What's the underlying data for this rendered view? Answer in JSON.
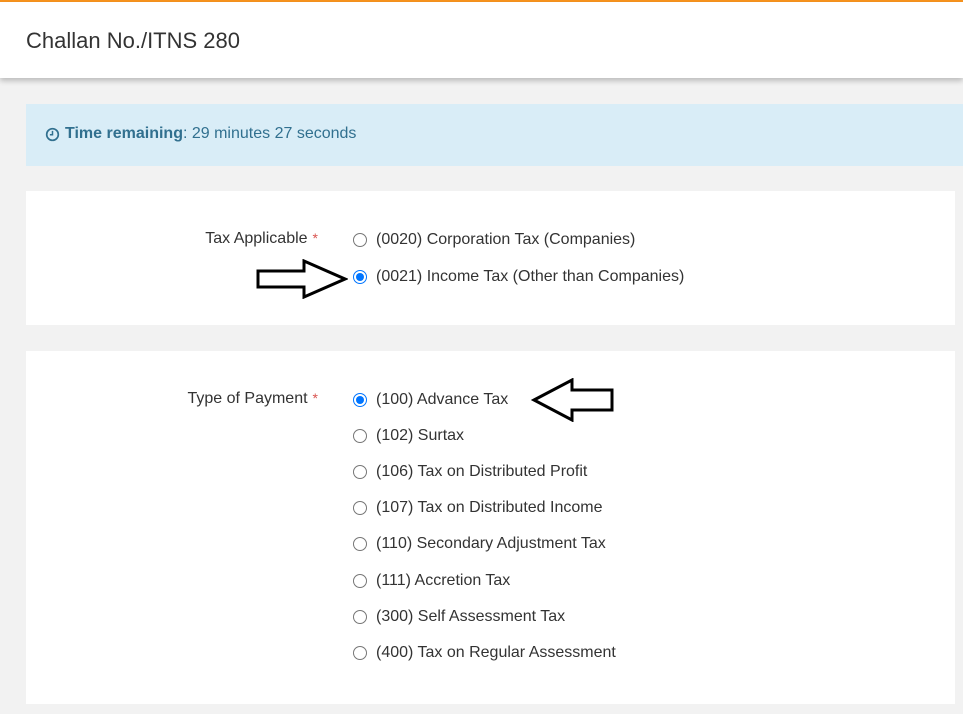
{
  "header": {
    "title": "Challan No./ITNS 280"
  },
  "timer": {
    "icon": "clock-icon",
    "label": "Time remaining",
    "value": ": 29 minutes 27 seconds"
  },
  "tax_applicable": {
    "label": "Tax Applicable",
    "required_mark": "*",
    "selected": "(0021) Income Tax (Other than Companies)",
    "options": [
      {
        "label": "(0020) Corporation Tax (Companies)",
        "checked": false
      },
      {
        "label": "(0021) Income Tax (Other than Companies)",
        "checked": true
      }
    ]
  },
  "type_of_payment": {
    "label": "Type of Payment",
    "required_mark": "*",
    "selected": "(100) Advance Tax",
    "options": [
      {
        "label": "(100) Advance Tax",
        "checked": true
      },
      {
        "label": "(102) Surtax",
        "checked": false
      },
      {
        "label": "(106) Tax on Distributed Profit",
        "checked": false
      },
      {
        "label": "(107) Tax on Distributed Income",
        "checked": false
      },
      {
        "label": "(110) Secondary Adjustment Tax",
        "checked": false
      },
      {
        "label": "(111) Accretion Tax",
        "checked": false
      },
      {
        "label": "(300) Self Assessment Tax",
        "checked": false
      },
      {
        "label": "(400) Tax on Regular Assessment",
        "checked": false
      }
    ]
  },
  "colors": {
    "accent": "#f7931e",
    "info_bg": "#d9edf7",
    "info_text": "#31708f",
    "required": "#d9534f",
    "radio_checked": "#0075ff"
  },
  "annotations": [
    "right-arrow-icon",
    "left-arrow-icon"
  ]
}
